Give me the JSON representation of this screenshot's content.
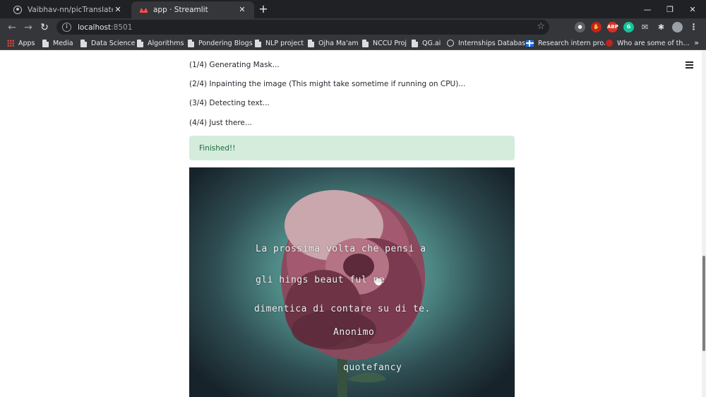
{
  "browser": {
    "tabs": [
      {
        "title": "Vaibhav-nn/picTranslate: An AI t",
        "active": false
      },
      {
        "title": "app · Streamlit",
        "active": true
      }
    ],
    "url_host": "localhost",
    "url_port": ":8501",
    "extensions": [
      "ABP",
      "G"
    ],
    "bookmarks": [
      {
        "label": "Apps",
        "icon": "apps-grid-icon"
      },
      {
        "label": "Media",
        "icon": "page-icon"
      },
      {
        "label": "Data Science",
        "icon": "page-icon"
      },
      {
        "label": "Algorithms",
        "icon": "page-icon"
      },
      {
        "label": "Pondering Blogs",
        "icon": "page-icon"
      },
      {
        "label": "NLP project",
        "icon": "page-icon"
      },
      {
        "label": "Ojha Ma'am",
        "icon": "page-icon"
      },
      {
        "label": "NCCU Proj",
        "icon": "page-icon"
      },
      {
        "label": "QG.ai",
        "icon": "page-icon"
      },
      {
        "label": "Internships Databas...",
        "icon": "globe-icon"
      },
      {
        "label": "Research intern pro...",
        "icon": "flag-icon"
      },
      {
        "label": "Who are some of th...",
        "icon": "quora-icon"
      }
    ],
    "more_bookmarks": "»"
  },
  "app": {
    "steps": [
      "(1/4) Generating Mask...",
      "(2/4) Inpainting the image (This might take sometime if running on CPU)...",
      "(3/4) Detecting text...",
      "(4/4) Just there..."
    ],
    "success_message": "Finished!!",
    "image_text": {
      "line1": "La prossima volta che pensi a",
      "line2": "gli hings beaut ful ne",
      "line3": "dimentica di contare su di te.",
      "author": "Anonimo",
      "credit": "quotefancy"
    }
  },
  "colors": {
    "tab_strip": "#202124",
    "toolbar": "#35363a",
    "success_bg": "#d5ecdc",
    "success_text": "#176c3a"
  }
}
